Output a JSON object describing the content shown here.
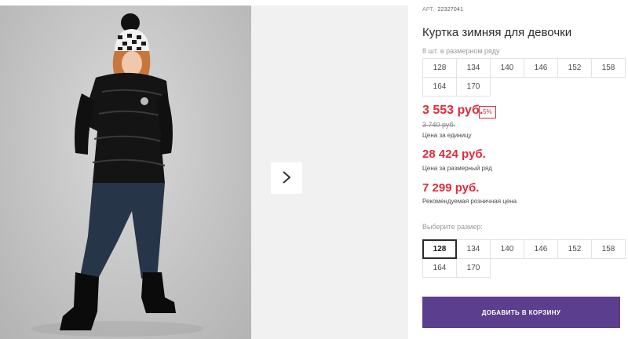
{
  "product": {
    "article_label": "АРТ.",
    "article_value": "22327041",
    "title": "Куртка зимняя для девочки",
    "series_note": "8 шт. в размерном ряду",
    "series_sizes": [
      "128",
      "134",
      "140",
      "146",
      "152",
      "158",
      "164",
      "170"
    ]
  },
  "pricing": {
    "price": "3 553 руб.",
    "discount": "5%",
    "old_price": "3 740 руб.",
    "unit_label": "Цена за единицу",
    "series_price": "28 424 руб.",
    "series_label": "Цена за размерный ряд",
    "retail_price": "7 299 руб.",
    "retail_label": "Рекомендуемая розничная цена"
  },
  "size_selector": {
    "label": "Выберите размер:",
    "selected": "128",
    "options": [
      "128",
      "134",
      "140",
      "146",
      "152",
      "158",
      "164",
      "170"
    ]
  },
  "cart": {
    "button_label": "ДОБАВИТЬ В КОРЗИНУ"
  },
  "gallery": {
    "next_icon": "chevron-right-icon"
  },
  "colors": {
    "price": "#e02b3c",
    "accent": "#5b3f8e",
    "border": "#e3e3e3"
  }
}
